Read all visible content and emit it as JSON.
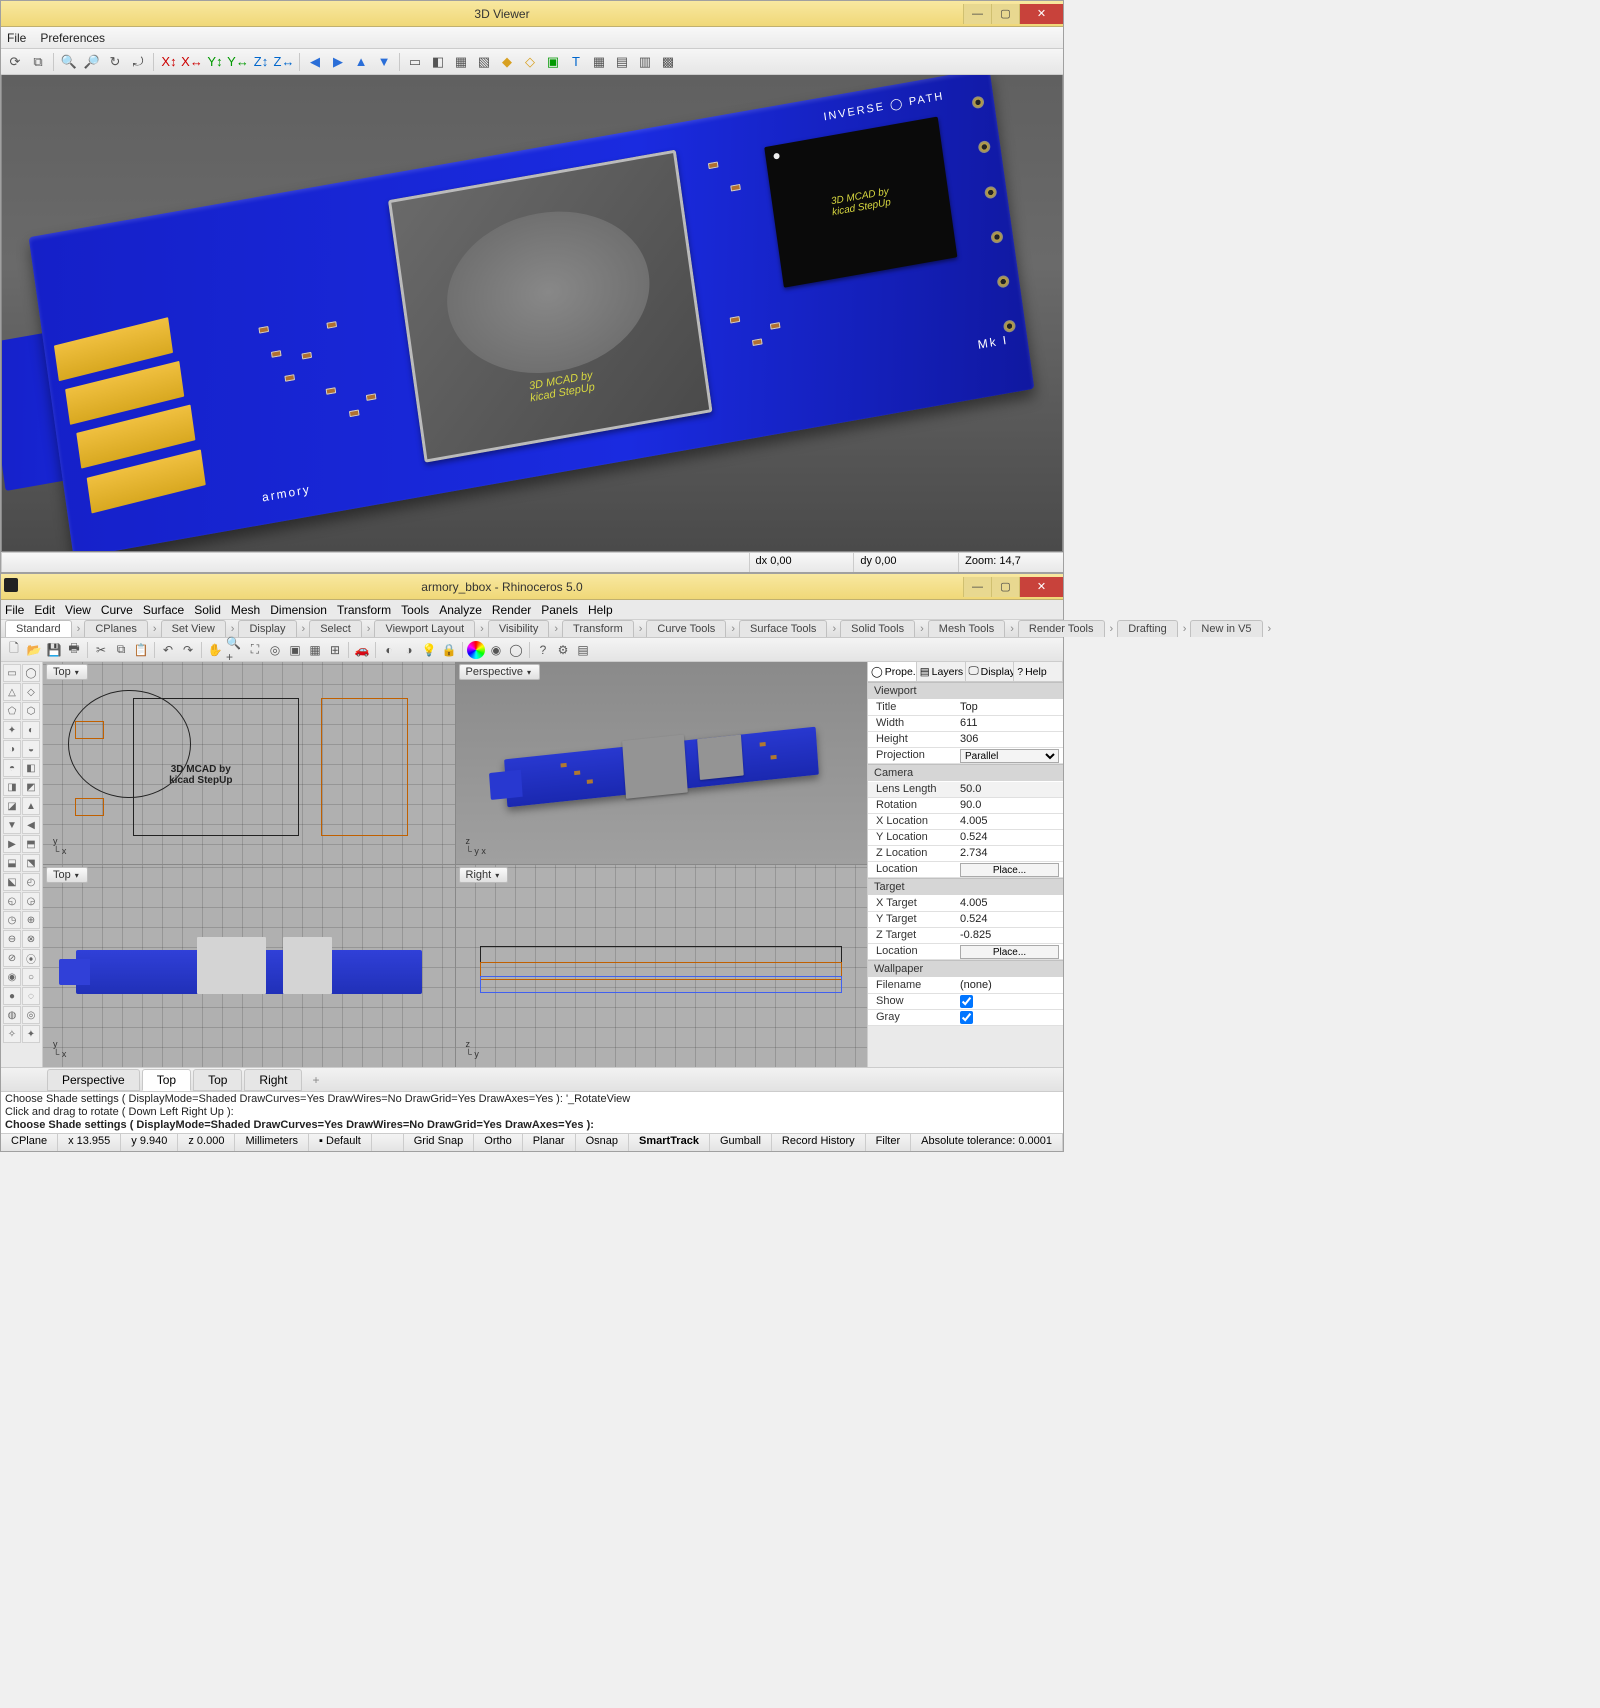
{
  "viewer": {
    "title": "3D Viewer",
    "menu": [
      "File",
      "Preferences"
    ],
    "status": {
      "dx": "dx 0,00",
      "dy": "dy 0,00",
      "zoom": "Zoom: 14,7"
    },
    "silk": {
      "armory": "armory",
      "inverse": "INVERSE ◯ PATH",
      "mk": "Mk I"
    },
    "chip_text_1": "3D MCAD by",
    "chip_text_2": "kicad StepUp"
  },
  "rhino": {
    "title": "armory_bbox - Rhinoceros 5.0",
    "menu": [
      "File",
      "Edit",
      "View",
      "Curve",
      "Surface",
      "Solid",
      "Mesh",
      "Dimension",
      "Transform",
      "Tools",
      "Analyze",
      "Render",
      "Panels",
      "Help"
    ],
    "command_tabs": [
      "Standard",
      "CPlanes",
      "Set View",
      "Display",
      "Select",
      "Viewport Layout",
      "Visibility",
      "Transform",
      "Curve Tools",
      "Surface Tools",
      "Solid Tools",
      "Mesh Tools",
      "Render Tools",
      "Drafting",
      "New in V5"
    ],
    "viewports": {
      "tl": "Top",
      "tr": "Perspective",
      "bl": "Top",
      "br": "Right",
      "wire_text_1": "3D MCAD by",
      "wire_text_2": "kicad StepUp"
    },
    "rightpanel": {
      "tabs": [
        "Prope..",
        "Layers",
        "Display",
        "Help"
      ],
      "sections": {
        "viewport": {
          "label": "Viewport",
          "Title": "Top",
          "Width": "611",
          "Height": "306",
          "Projection": "Parallel"
        },
        "camera": {
          "label": "Camera",
          "Lens Length": "50.0",
          "Rotation": "90.0",
          "X Location": "4.005",
          "Y Location": "0.524",
          "Z Location": "2.734",
          "Location_btn": "Place..."
        },
        "target": {
          "label": "Target",
          "X Target": "4.005",
          "Y Target": "0.524",
          "Z Target": "-0.825",
          "Location_btn": "Place..."
        },
        "wallpaper": {
          "label": "Wallpaper",
          "Filename": "(none)",
          "Show": true,
          "Gray": true
        }
      }
    },
    "vp_tabs_bottom": [
      "Perspective",
      "Top",
      "Top",
      "Right"
    ],
    "cmd": {
      "line1": "Choose Shade settings ( DisplayMode=Shaded  DrawCurves=Yes  DrawWires=No  DrawGrid=Yes  DrawAxes=Yes ): '_RotateView",
      "line2": "Click and drag to rotate ( Down  Left  Right  Up ):",
      "prompt": "Choose Shade settings ( DisplayMode=Shaded  DrawCurves=Yes  DrawWires=No  DrawGrid=Yes  DrawAxes=Yes ): "
    },
    "status": {
      "cplane": "CPlane",
      "x": "x 13.955",
      "y": "y 9.940",
      "z": "z 0.000",
      "units": "Millimeters",
      "layer": "Default",
      "toggles": [
        "Grid Snap",
        "Ortho",
        "Planar",
        "Osnap",
        "SmartTrack",
        "Gumball",
        "Record History",
        "Filter"
      ],
      "tol": "Absolute tolerance: 0.0001"
    }
  }
}
